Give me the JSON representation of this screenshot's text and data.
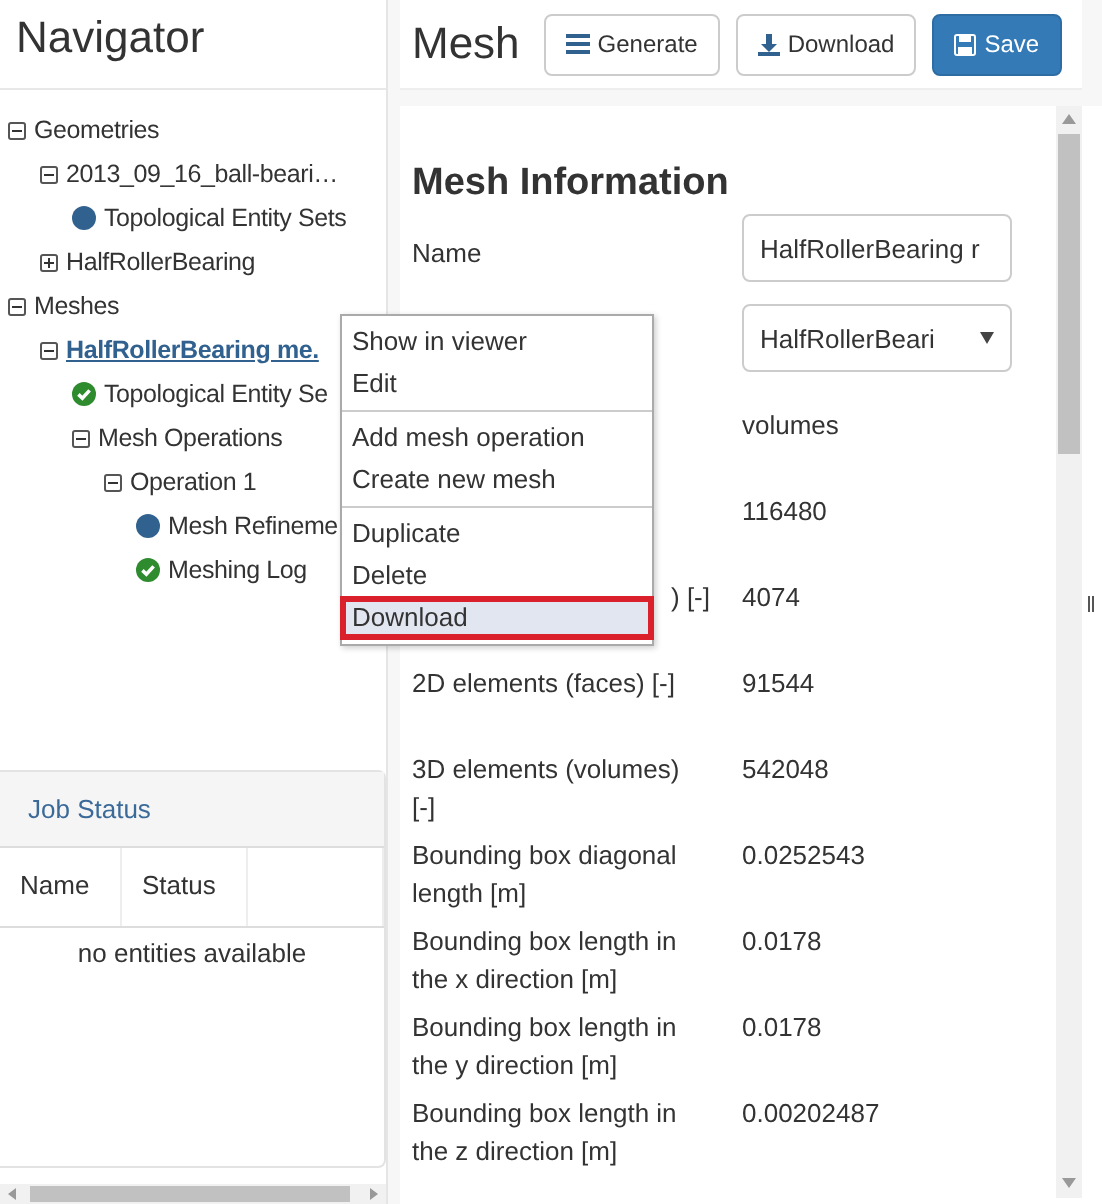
{
  "navigator": {
    "title": "Navigator",
    "tree": [
      {
        "label": "Geometries",
        "kind": "toggle",
        "expanded": true,
        "selected": false,
        "children": [
          {
            "label": "2013_09_16_ball-beari…",
            "kind": "toggle",
            "expanded": true,
            "selected": false,
            "children": [
              {
                "label": "Topological Entity Sets",
                "kind": "dot",
                "selected": false
              }
            ]
          },
          {
            "label": "HalfRollerBearing",
            "kind": "toggle",
            "expanded": false,
            "selected": false
          }
        ]
      },
      {
        "label": "Meshes",
        "kind": "toggle",
        "expanded": true,
        "selected": false,
        "children": [
          {
            "label": "HalfRollerBearing me.",
            "kind": "toggle",
            "expanded": true,
            "selected": true,
            "children": [
              {
                "label": "Topological Entity Se",
                "kind": "check",
                "selected": false
              },
              {
                "label": "Mesh Operations",
                "kind": "toggle",
                "expanded": true,
                "selected": false,
                "children": [
                  {
                    "label": "Operation 1",
                    "kind": "toggle",
                    "expanded": true,
                    "selected": false,
                    "children": [
                      {
                        "label": "Mesh Refineme",
                        "kind": "dot",
                        "selected": false
                      },
                      {
                        "label": "Meshing Log",
                        "kind": "check",
                        "selected": false
                      }
                    ]
                  }
                ]
              }
            ]
          }
        ]
      }
    ]
  },
  "job_status": {
    "title": "Job Status",
    "columns": [
      "Name",
      "Status"
    ],
    "empty": "no entities available"
  },
  "mesh": {
    "title": "Mesh",
    "buttons": [
      {
        "label": "Generate",
        "kind": "generate"
      },
      {
        "label": "Download",
        "kind": "download"
      },
      {
        "label": "Save",
        "kind": "save"
      }
    ],
    "section_title": "Mesh Information",
    "rows": [
      {
        "kind": "input",
        "label": "Name",
        "value": "HalfRollerBearing r"
      },
      {
        "kind": "select",
        "value": "HalfRollerBeari"
      },
      {
        "kind": "text",
        "value": "volumes"
      },
      {
        "kind": "text",
        "value": "116480"
      },
      {
        "kind": "clipped",
        "label": ") [-]",
        "value": "4074"
      },
      {
        "kind": "text",
        "label": "2D elements (faces) [-]",
        "value": "91544"
      },
      {
        "kind": "text",
        "label": "3D elements (volumes) [-]",
        "value": "542048"
      },
      {
        "kind": "text",
        "label": "Bounding box diagonal length [m]",
        "value": "0.0252543"
      },
      {
        "kind": "text",
        "label": "Bounding box length in the x direction [m]",
        "value": "0.0178"
      },
      {
        "kind": "text",
        "label": "Bounding box length in the y direction [m]",
        "value": "0.0178"
      },
      {
        "kind": "text",
        "label": "Bounding box length in the z direction [m]",
        "value": "0.00202487"
      }
    ]
  },
  "context_menu": {
    "groups": [
      [
        {
          "label": "Show in viewer",
          "highlighted": false
        },
        {
          "label": "Edit",
          "highlighted": false
        }
      ],
      [
        {
          "label": "Add mesh operation",
          "highlighted": false
        },
        {
          "label": "Create new mesh",
          "highlighted": false
        }
      ],
      [
        {
          "label": "Duplicate",
          "highlighted": false
        },
        {
          "label": "Delete",
          "highlighted": false
        },
        {
          "label": "Download",
          "highlighted": true
        }
      ]
    ]
  }
}
